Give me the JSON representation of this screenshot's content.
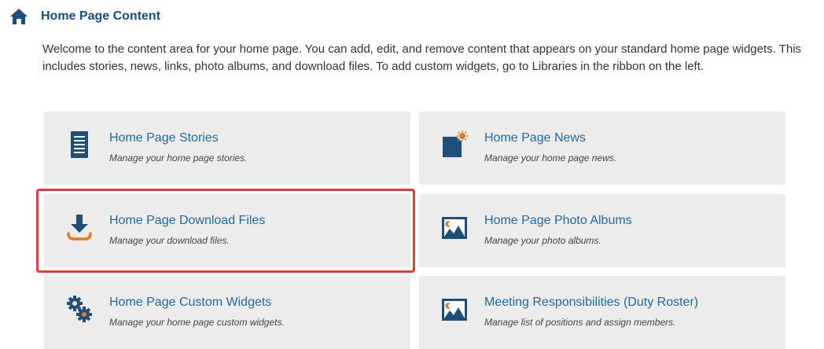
{
  "header": {
    "title": "Home Page Content",
    "icon": "home-icon"
  },
  "intro": "Welcome to the content area for your home page. You can add, edit, and remove content that appears on your standard home page widgets. This includes stories, news, links, photo albums, and download files. To add custom widgets, go to Libraries in the ribbon on the left.",
  "cards": [
    {
      "title": "Home Page Stories",
      "desc": "Manage your home page stories.",
      "icon": "document-list-icon"
    },
    {
      "title": "Home Page News",
      "desc": "Manage your home page news.",
      "icon": "news-icon"
    },
    {
      "title": "Home Page Download Files",
      "desc": "Manage your download files.",
      "icon": "download-icon",
      "highlighted": true
    },
    {
      "title": "Home Page Photo Albums",
      "desc": "Manage your photo albums.",
      "icon": "photo-album-icon"
    },
    {
      "title": "Home Page Custom Widgets",
      "desc": "Manage your home page custom widgets.",
      "icon": "gears-icon"
    },
    {
      "title": "Meeting Responsibilities (Duty Roster)",
      "desc": "Manage list of positions and assign members.",
      "icon": "photo-icon"
    }
  ],
  "colors": {
    "title": "#1a4e7a",
    "link": "#1e6ba0",
    "card_bg": "#ececec",
    "highlight": "#d9403a",
    "accent": "#e07b2a",
    "icon_dark": "#1f4e79"
  }
}
